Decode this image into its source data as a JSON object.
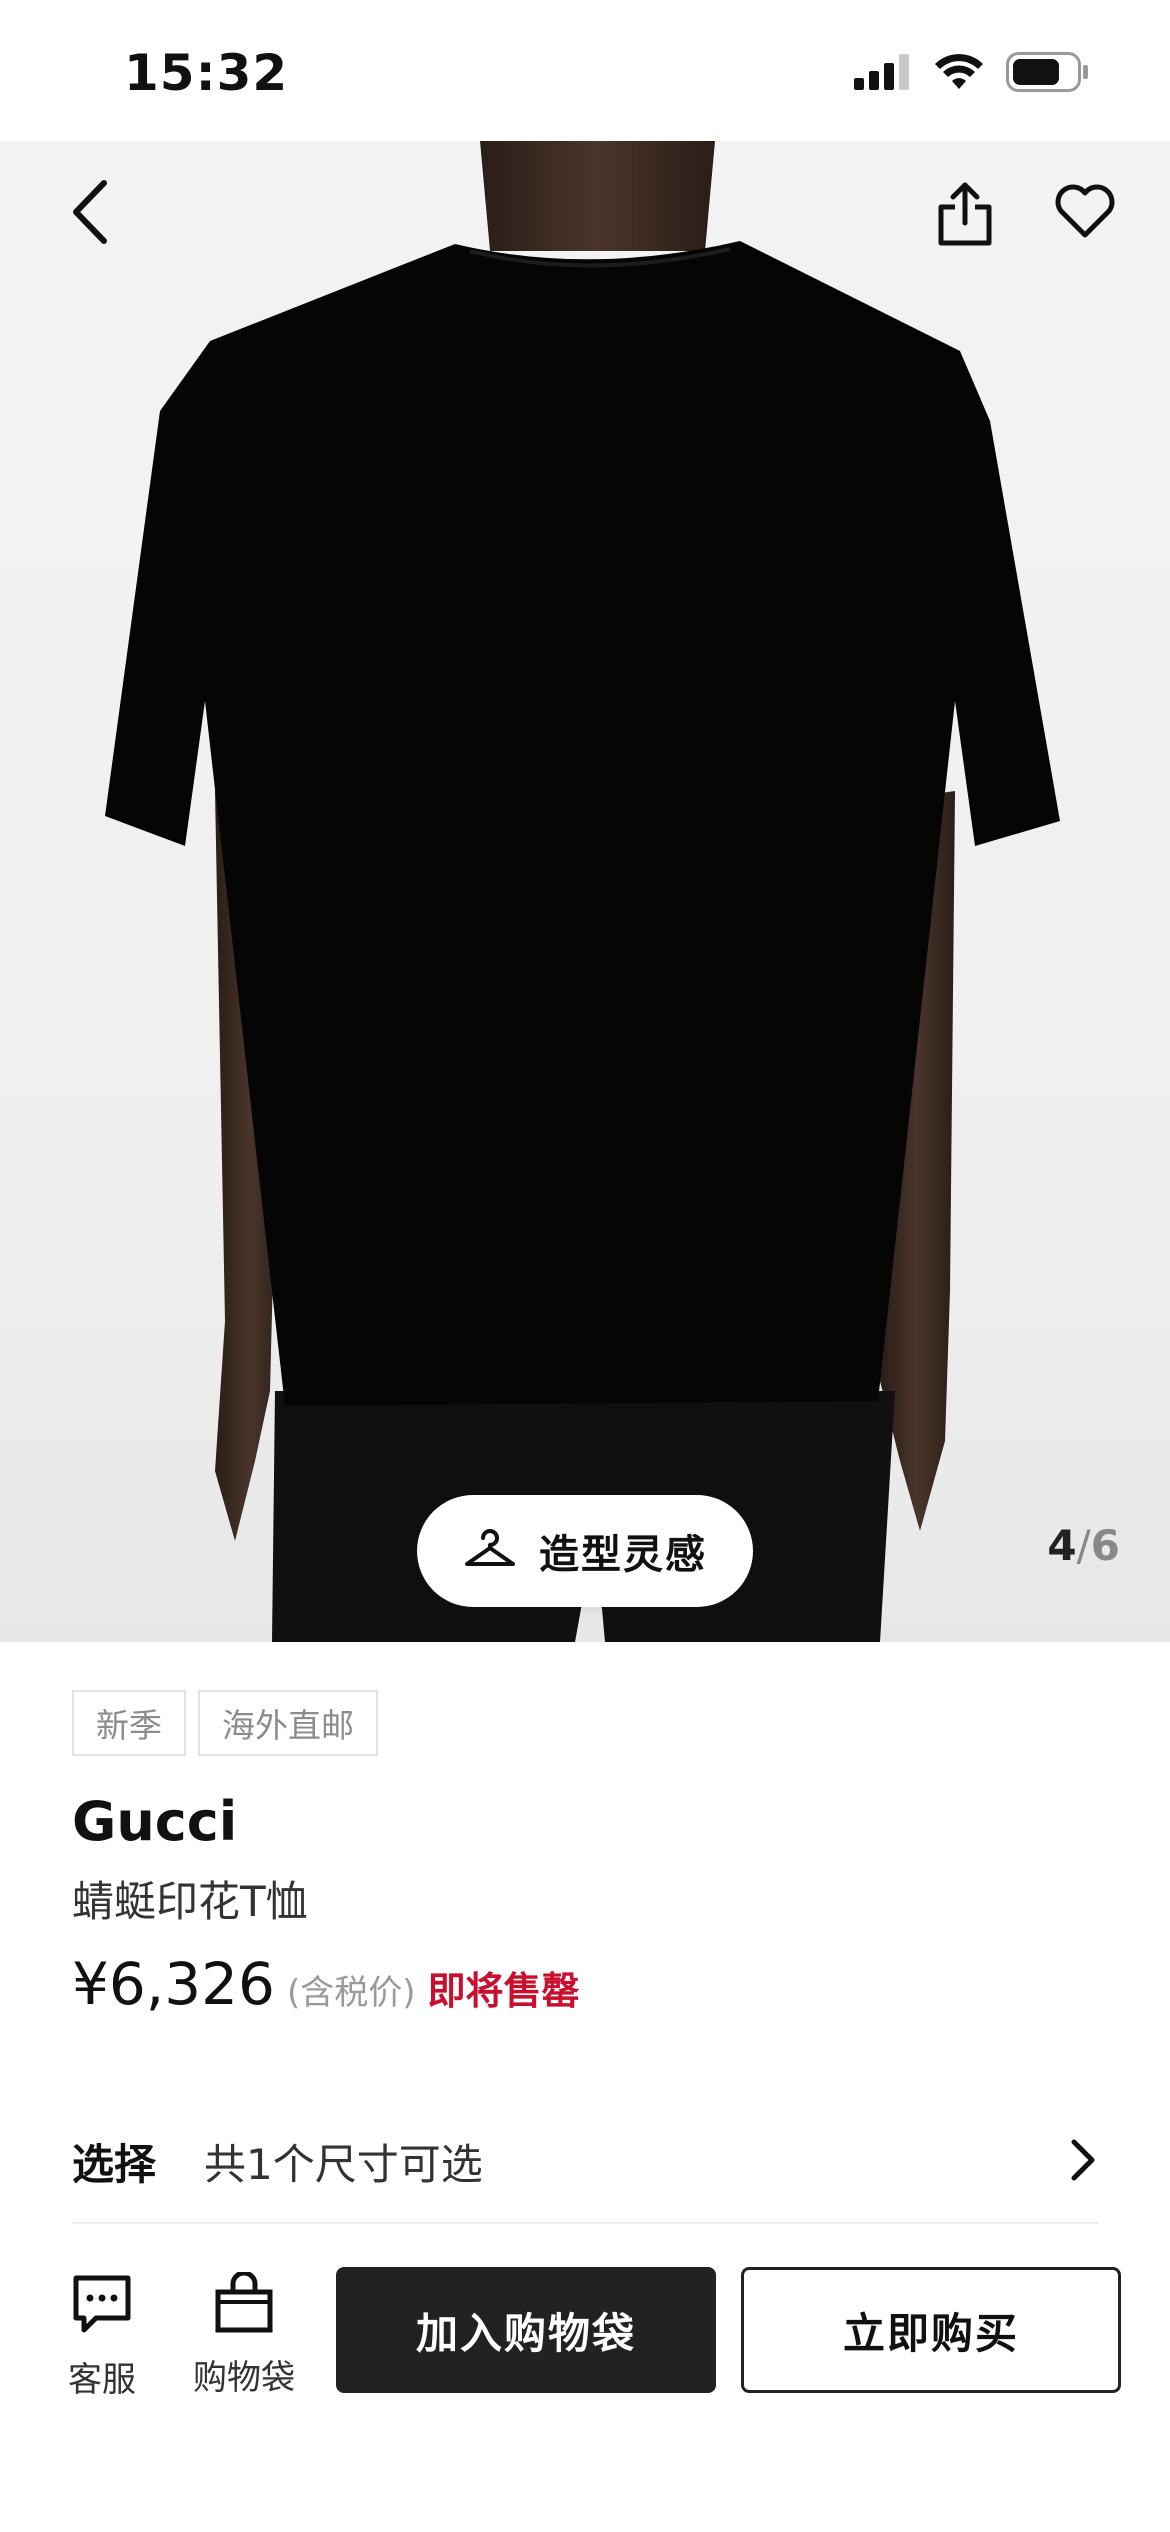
{
  "status_bar": {
    "time": "15:32",
    "icons": [
      "signal-icon",
      "wifi-icon",
      "battery-icon"
    ]
  },
  "hero": {
    "icons": [
      "back-arrow-icon",
      "share-icon",
      "heart-icon",
      "hanger-icon"
    ],
    "style_button_label": "造型灵感",
    "image_index": "4",
    "image_separator": "/",
    "image_total": "6"
  },
  "product": {
    "tags": [
      "新季",
      "海外直邮"
    ],
    "brand": "Gucci",
    "name": "蜻蜓印花T恤",
    "price": "¥6,326",
    "tax_note": "(含税价)",
    "stock_note": "即将售罄",
    "stock_color": "#c8102e"
  },
  "size_selector": {
    "label": "选择",
    "value": "共1个尺寸可选"
  },
  "bottom_bar": {
    "service_label": "客服",
    "bag_label": "购物袋",
    "add_to_bag_label": "加入购物袋",
    "buy_now_label": "立即购买"
  }
}
